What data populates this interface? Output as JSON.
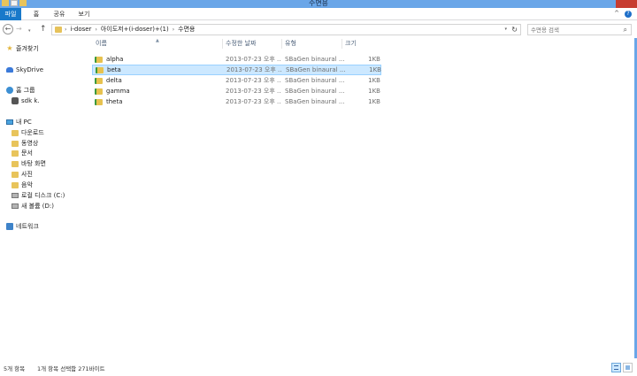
{
  "window": {
    "title": "수면용"
  },
  "ribbon": {
    "tabs": [
      "파일",
      "홈",
      "공유",
      "보기"
    ],
    "help": "?",
    "collapse": "^"
  },
  "nav": {
    "back": "←",
    "forward": "→",
    "recent": "▾",
    "up": "↑"
  },
  "address": {
    "crumbs": [
      "i-doser",
      "아이도저+(i-doser)+(1)",
      "수면용"
    ],
    "separator": "›",
    "dropdown": "▾",
    "refresh": "↻"
  },
  "search": {
    "placeholder": "수면용 검색",
    "icon": "⌕"
  },
  "navpane": {
    "favorites": "즐겨찾기",
    "skydrive": "SkyDrive",
    "homegroup": "홈 그룹",
    "homegroup_user": "sdk k.",
    "pc": "내 PC",
    "pc_items": [
      {
        "label": "다운로드",
        "icon": "folder-icon"
      },
      {
        "label": "동영상",
        "icon": "folder-icon"
      },
      {
        "label": "문서",
        "icon": "folder-icon"
      },
      {
        "label": "바탕 화면",
        "icon": "folder-icon"
      },
      {
        "label": "사진",
        "icon": "folder-icon"
      },
      {
        "label": "음악",
        "icon": "folder-icon"
      },
      {
        "label": "로컬 디스크 (C:)",
        "icon": "drive-icon"
      },
      {
        "label": "새 볼륨 (D:)",
        "icon": "drive-icon"
      }
    ],
    "network": "네트워크"
  },
  "columns": {
    "name": "이름",
    "date": "수정한 날짜",
    "type": "유형",
    "size": "크기",
    "sort_arrow": "▲"
  },
  "files": [
    {
      "name": "alpha",
      "date": "2013-07-23 오후 ...",
      "type": "SBaGen binaural ...",
      "size": "1KB"
    },
    {
      "name": "beta",
      "date": "2013-07-23 오후 ...",
      "type": "SBaGen binaural ...",
      "size": "1KB",
      "selected": true
    },
    {
      "name": "delta",
      "date": "2013-07-23 오후 ...",
      "type": "SBaGen binaural ...",
      "size": "1KB"
    },
    {
      "name": "gamma",
      "date": "2013-07-23 오후 ...",
      "type": "SBaGen binaural ...",
      "size": "1KB"
    },
    {
      "name": "theta",
      "date": "2013-07-23 오후 ...",
      "type": "SBaGen binaural ...",
      "size": "1KB"
    }
  ],
  "status": {
    "item_count": "5개 항목",
    "selection": "1개 항목 선택함 271바이트"
  },
  "colors": {
    "accent": "#1979ca",
    "titlebar": "#6aa6e8",
    "selection": "#cce8ff",
    "folder": "#e8c45b"
  }
}
